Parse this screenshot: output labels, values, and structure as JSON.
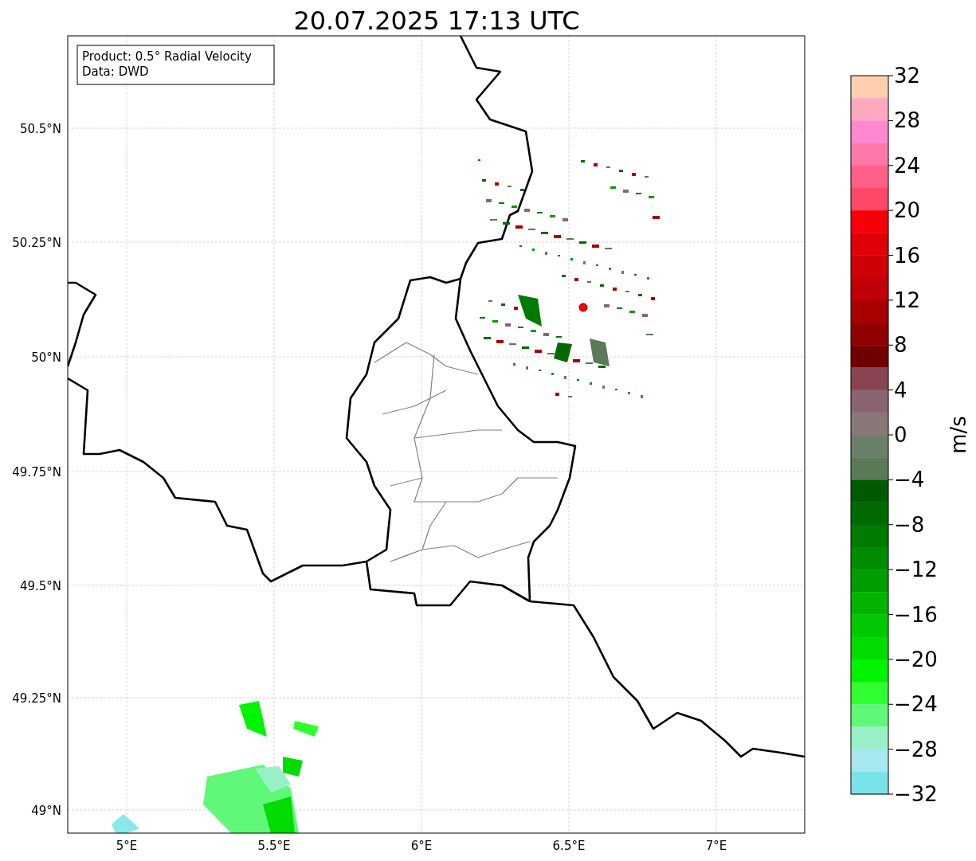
{
  "title": "20.07.2025 17:13 UTC",
  "info_box": [
    "Product: 0.5° Radial Velocity",
    "Data: DWD"
  ],
  "map": {
    "xticks": [
      "5°E",
      "5.5°E",
      "6°E",
      "6.5°E",
      "7°E"
    ],
    "yticks": [
      "50.5°N",
      "50.25°N",
      "50°N",
      "49.75°N",
      "49.5°N",
      "49.25°N",
      "49°N"
    ]
  },
  "colorbar": {
    "label": "m/s",
    "ticks": [
      "32",
      "28",
      "24",
      "20",
      "16",
      "12",
      "8",
      "4",
      "0",
      "−4",
      "−8",
      "−12",
      "−16",
      "−20",
      "−24",
      "−28",
      "−32"
    ],
    "bands": [
      {
        "color": "#ffcfb0"
      },
      {
        "color": "#ffa8c0"
      },
      {
        "color": "#ff88d0"
      },
      {
        "color": "#ff78a8"
      },
      {
        "color": "#ff6088"
      },
      {
        "color": "#ff4868"
      },
      {
        "color": "#f50008"
      },
      {
        "color": "#e00008"
      },
      {
        "color": "#d00008"
      },
      {
        "color": "#c00008"
      },
      {
        "color": "#a80000"
      },
      {
        "color": "#900000"
      },
      {
        "color": "#700000"
      },
      {
        "color": "#884450"
      },
      {
        "color": "#8a6470"
      },
      {
        "color": "#8a7878"
      },
      {
        "color": "#6a8068"
      },
      {
        "color": "#5a7a58"
      },
      {
        "color": "#005a00"
      },
      {
        "color": "#006a00"
      },
      {
        "color": "#007a00"
      },
      {
        "color": "#008c00"
      },
      {
        "color": "#009c00"
      },
      {
        "color": "#00b400"
      },
      {
        "color": "#00c800"
      },
      {
        "color": "#00dc00"
      },
      {
        "color": "#00f400"
      },
      {
        "color": "#30ff30"
      },
      {
        "color": "#60f878"
      },
      {
        "color": "#98f0c8"
      },
      {
        "color": "#a8e8f0"
      },
      {
        "color": "#78e4e8"
      }
    ]
  }
}
